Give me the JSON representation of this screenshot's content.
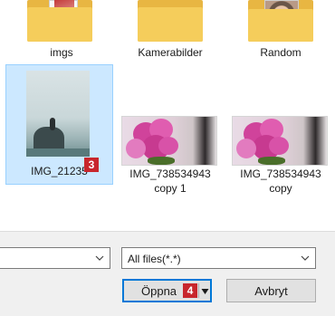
{
  "files": [
    {
      "name": "imgs",
      "kind": "folder"
    },
    {
      "name": "Kamerabilder",
      "kind": "folder"
    },
    {
      "name": "Random",
      "kind": "folder"
    },
    {
      "name": "IMG_21235",
      "kind": "image",
      "selected": true,
      "step_badge": "3"
    },
    {
      "name_line1": "IMG_738534943",
      "name_line2": "copy 1",
      "kind": "image"
    },
    {
      "name_line1": "IMG_738534943",
      "name_line2": "copy",
      "kind": "image"
    }
  ],
  "filename_field": {
    "value": ""
  },
  "filetype_select": {
    "selected": "All files(*.*)"
  },
  "open_button": {
    "label": "Öppna",
    "step_badge": "4"
  },
  "cancel_button": {
    "label": "Avbryt"
  },
  "colors": {
    "selection": "#cce8ff",
    "selection_border": "#99d1ff",
    "badge": "#c8262c",
    "focus_border": "#0078d7"
  }
}
